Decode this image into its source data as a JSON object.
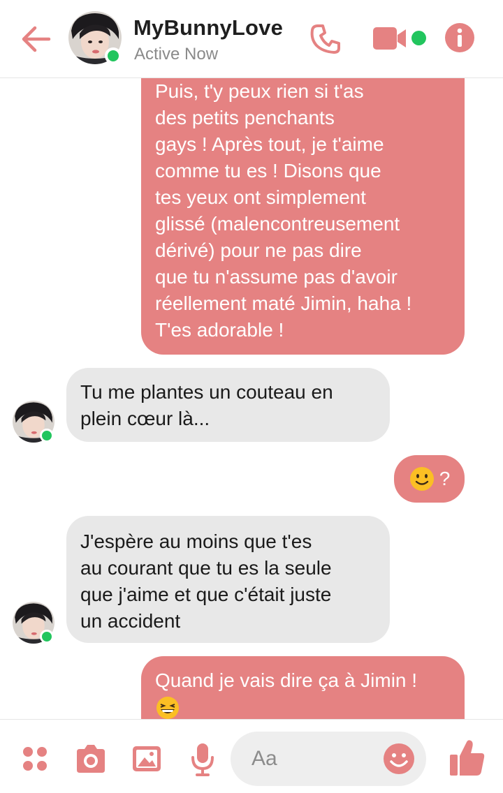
{
  "header": {
    "contact_name": "MyBunnyLove",
    "status": "Active Now",
    "back_icon": "arrow-left-icon",
    "call_icon": "phone-icon",
    "video_icon": "video-camera-icon",
    "info_icon": "info-icon"
  },
  "messages": [
    {
      "direction": "outgoing",
      "lines": [
        "Puis, t'y peux rien si t'as",
        "des petits penchants",
        "gays ! Après tout, je t'aime",
        "comme tu es ! Disons que",
        "tes yeux ont simplement",
        "glissé (malencontreusement",
        "dérivé) pour ne pas dire",
        "que tu n'assume pas d'avoir",
        "réellement maté Jimin, haha !",
        "T'es adorable !"
      ]
    },
    {
      "direction": "incoming",
      "lines": [
        "Tu me plantes un couteau en",
        "plein cœur là..."
      ]
    },
    {
      "direction": "outgoing",
      "emoji": "slightly-smiling-face",
      "text": "?"
    },
    {
      "direction": "incoming",
      "lines": [
        "J'espère au moins que t'es",
        "au courant que tu es la seule",
        "que j'aime et que c'était juste",
        "un accident"
      ]
    },
    {
      "direction": "outgoing",
      "lines": [
        "Quand je vais dire ça à Jimin !"
      ],
      "emoji": "grinning-squinting-face"
    }
  ],
  "composer": {
    "placeholder": "Aa",
    "icons": [
      "apps-icon",
      "camera-icon",
      "image-icon",
      "microphone-icon",
      "emoji-icon",
      "thumbs-up-icon"
    ]
  },
  "colors": {
    "accent": "#e58282",
    "outgoing_bubble": "#e58282",
    "incoming_bubble": "#e8e8e8",
    "online": "#22c55e",
    "header_title": "#1f1f1f",
    "muted": "#8a8a8a"
  }
}
